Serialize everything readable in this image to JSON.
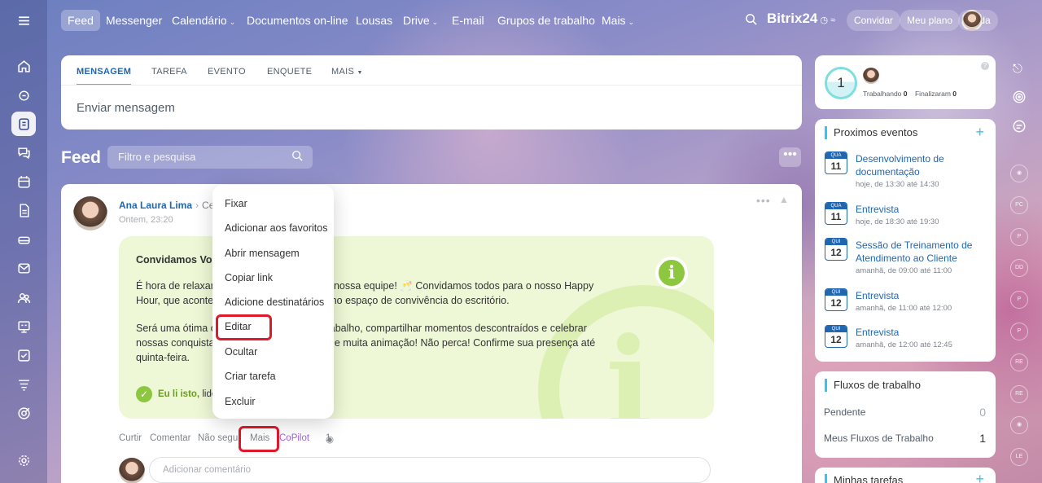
{
  "nav": {
    "items": [
      {
        "label": "Feed",
        "active": true
      },
      {
        "label": "Messenger"
      },
      {
        "label": "Calendário",
        "chevron": true
      },
      {
        "label": "Documentos on-line"
      },
      {
        "label": "Lousas"
      },
      {
        "label": "Drive",
        "chevron": true
      },
      {
        "label": "E-mail"
      },
      {
        "label": "Grupos de trabalho"
      },
      {
        "label": "Mais",
        "chevron": true
      }
    ],
    "brand": "Bitrix",
    "brand_suffix": "24",
    "invite": "Convidar",
    "plan": "Meu plano",
    "help": "Ajuda"
  },
  "composer": {
    "tabs": [
      "MENSAGEM",
      "TAREFA",
      "EVENTO",
      "ENQUETE",
      "MAIS"
    ],
    "placeholder": "Enviar mensagem"
  },
  "feed": {
    "title": "Feed",
    "search_placeholder": "Filtro e pesquisa"
  },
  "post": {
    "author": "Ana Laura Lima",
    "destination": "Ce",
    "time": "Ontem, 23:20",
    "title_start": "Convidamos Voc",
    "title_end": "r!",
    "para1_line1_start": "É hora de relaxar,",
    "para1_line1_end": "ços da nossa equipe! 🥂 Convidamos todos para o nosso Happy",
    "para1_line2_start": "Hour, que aconte",
    "para1_line2_end": "às 18h, no espaço de convivência do escritório.",
    "para2_line1_start": "Será uma ótima o",
    "para2_line1_end": "tar do trabalho, compartilhar momentos descontraídos e celebrar",
    "para2_line2_start": "nossas conquista",
    "para2_line2_end": "bebidas e muita animação! Não perca! Confirme sua presença até",
    "para2_line3": "quinta-feira.",
    "read_label": "Eu li isto,",
    "read_rest": "lido",
    "actions": {
      "like": "Curtir",
      "comment": "Comentar",
      "unfollow": "Não segui",
      "more": "Mais",
      "copilot": "CoPilot",
      "views": "1"
    },
    "comment_placeholder": "Adicionar comentário"
  },
  "context_menu": [
    "Fixar",
    "Adicionar aos favoritos",
    "Abrir mensagem",
    "Copiar link",
    "Adicione destinatários",
    "Editar",
    "Ocultar",
    "Criar tarefa",
    "Excluir"
  ],
  "status": {
    "count": "1",
    "working_label": "Trabalhando",
    "working_value": "0",
    "finished_label": "Finalizaram",
    "finished_value": "0"
  },
  "events": {
    "title": "Proximos eventos",
    "items": [
      {
        "weekday": "QUA",
        "day": "11",
        "name": "Desenvolvimento de documentação",
        "time": "hoje, de 13:30 até 14:30"
      },
      {
        "weekday": "QUA",
        "day": "11",
        "name": "Entrevista",
        "time": "hoje, de 18:30 até 19:30"
      },
      {
        "weekday": "QUI",
        "day": "12",
        "name": "Sessão de Treinamento de Atendimento ao Cliente",
        "time": "amanhã, de 09:00 até 11:00"
      },
      {
        "weekday": "QUI",
        "day": "12",
        "name": "Entrevista",
        "time": "amanhã, de 11:00 até 12:00"
      },
      {
        "weekday": "QUI",
        "day": "12",
        "name": "Entrevista",
        "time": "amanhã, de 12:00 até 12:45"
      }
    ]
  },
  "workflows": {
    "title": "Fluxos de trabalho",
    "pending_label": "Pendente",
    "pending_value": "0",
    "mine_label": "Meus Fluxos de Trabalho",
    "mine_value": "1"
  },
  "tasks": {
    "title": "Minhas tarefas"
  },
  "right_bar_badges": [
    "PC",
    "P",
    "DD",
    "P",
    "P",
    "RE",
    "RE",
    "LE"
  ],
  "colors": {
    "accent": "#2067b0",
    "highlight": "#e0182b",
    "announce_bg": "#eef8d6",
    "check_green": "#8dc63f"
  }
}
